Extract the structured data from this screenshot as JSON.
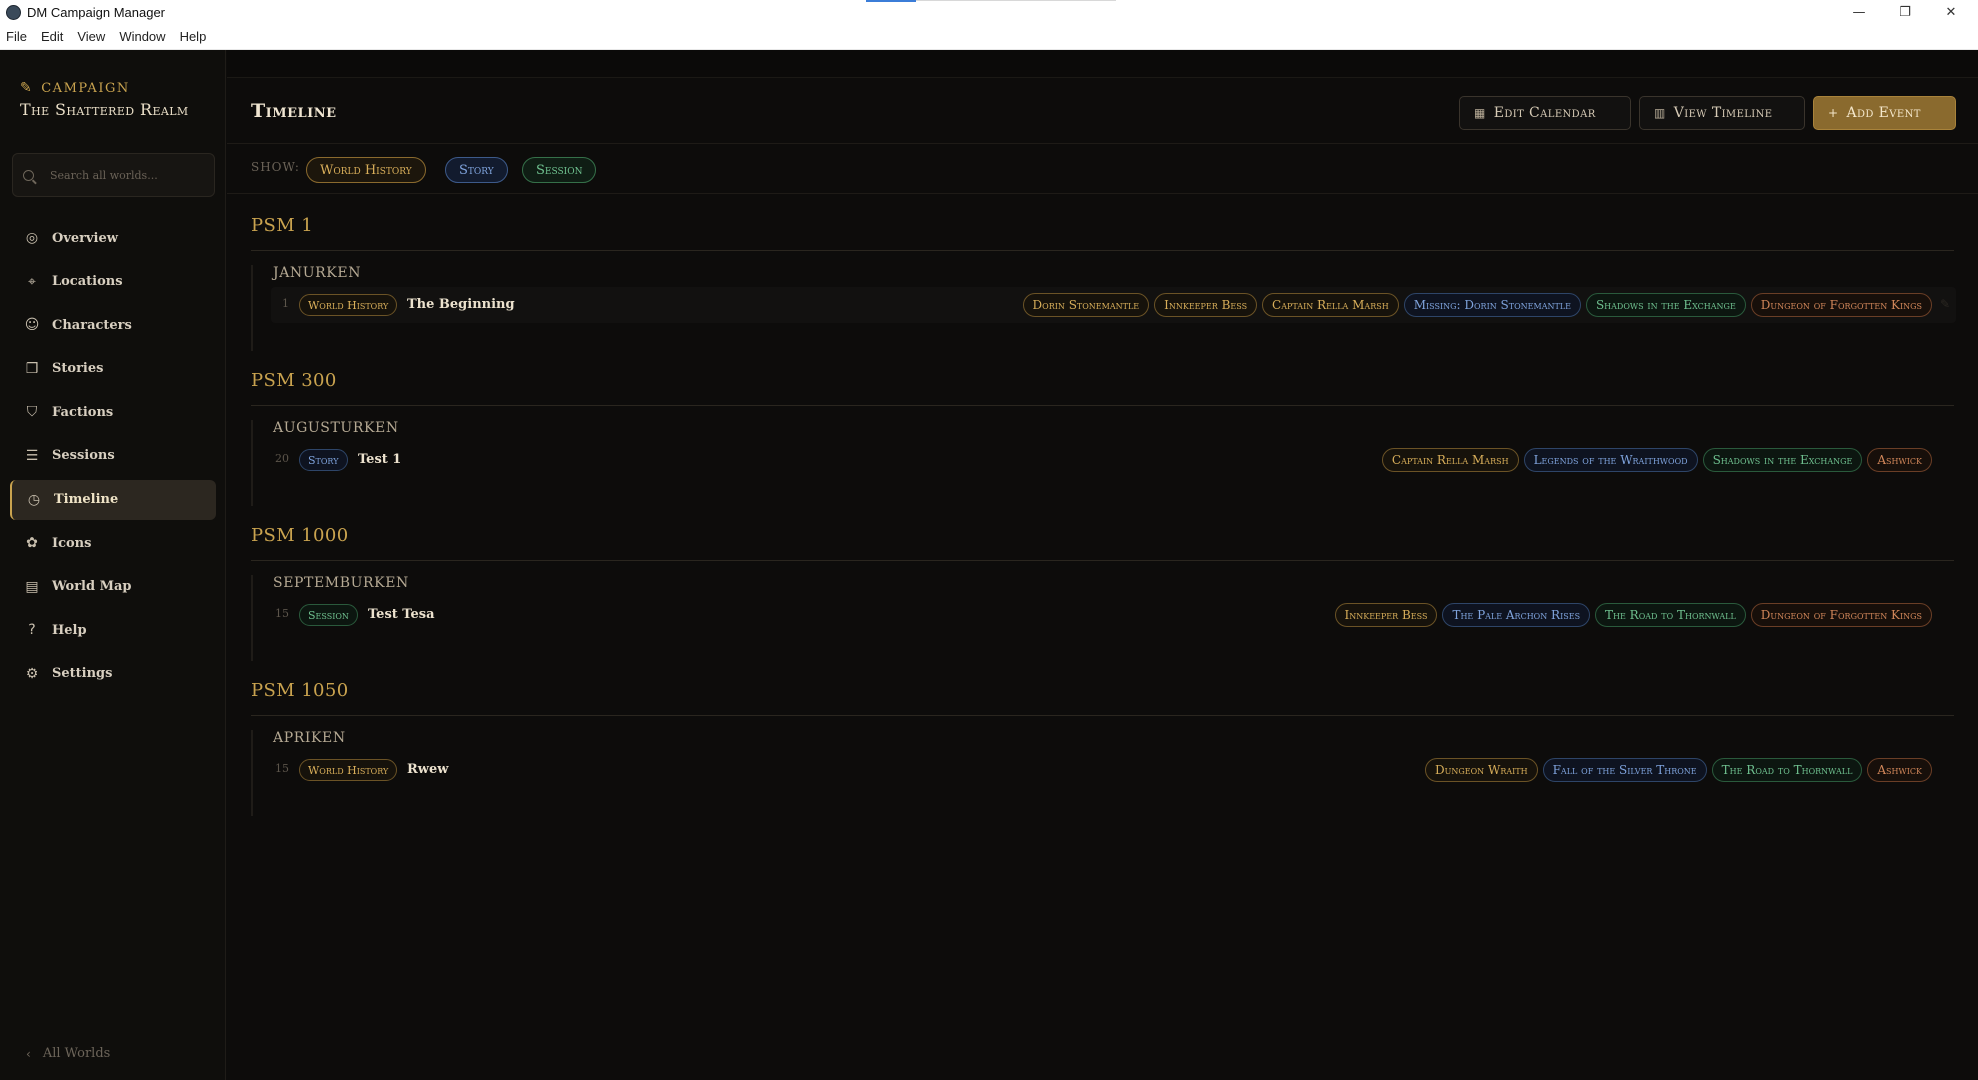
{
  "window": {
    "title": "DM Campaign Manager",
    "controls": {
      "minimize": "—",
      "restore": "❐",
      "close": "✕"
    }
  },
  "menu": [
    "File",
    "Edit",
    "View",
    "Window",
    "Help"
  ],
  "sidebar": {
    "campaign_label": "CAMPAIGN",
    "campaign_name": "The Shattered Realm",
    "search_placeholder": "Search all worlds...",
    "items": [
      {
        "label": "Overview",
        "icon": "globe-icon",
        "glyph": "◎"
      },
      {
        "label": "Locations",
        "icon": "map-pin-icon",
        "glyph": "⌖"
      },
      {
        "label": "Characters",
        "icon": "users-icon",
        "glyph": "☺"
      },
      {
        "label": "Stories",
        "icon": "book-icon",
        "glyph": "❒"
      },
      {
        "label": "Factions",
        "icon": "shield-icon",
        "glyph": "⛉"
      },
      {
        "label": "Sessions",
        "icon": "scroll-icon",
        "glyph": "☰"
      },
      {
        "label": "Timeline",
        "icon": "clock-icon",
        "glyph": "◷",
        "active": true
      },
      {
        "label": "Icons",
        "icon": "palette-icon",
        "glyph": "✿"
      },
      {
        "label": "World Map",
        "icon": "map-icon",
        "glyph": "▤"
      },
      {
        "label": "Help",
        "icon": "help-icon",
        "glyph": "?"
      },
      {
        "label": "Settings",
        "icon": "gear-icon",
        "glyph": "⚙"
      }
    ],
    "back_label": "All Worlds"
  },
  "header": {
    "title": "Timeline",
    "edit_calendar": "Edit Calendar",
    "view_timeline": "View Timeline",
    "add_event": "Add Event"
  },
  "filters": {
    "show_label": "SHOW:",
    "chips": [
      "World History",
      "Story",
      "Session"
    ]
  },
  "timeline": [
    {
      "year": "PSM 1",
      "month": "JANURKEN",
      "day": "1",
      "type": "World History",
      "title": "The Beginning",
      "tags": [
        {
          "label": "Dorin Stonemantle",
          "kind": "gold"
        },
        {
          "label": "Innkeeper Bess",
          "kind": "gold"
        },
        {
          "label": "Captain Rella Marsh",
          "kind": "gold"
        },
        {
          "label": "Missing: Dorin Stonemantle",
          "kind": "blue"
        },
        {
          "label": "Shadows in the Exchange",
          "kind": "green"
        },
        {
          "label": "Dungeon of Forgotten Kings",
          "kind": "orange"
        }
      ]
    },
    {
      "year": "PSM 300",
      "month": "AUGUSTURKEN",
      "day": "20",
      "type": "Story",
      "title": "Test 1",
      "tags": [
        {
          "label": "Captain Rella Marsh",
          "kind": "gold"
        },
        {
          "label": "Legends of the Wraithwood",
          "kind": "blue"
        },
        {
          "label": "Shadows in the Exchange",
          "kind": "green"
        },
        {
          "label": "Ashwick",
          "kind": "orange"
        }
      ]
    },
    {
      "year": "PSM 1000",
      "month": "SEPTEMBURKEN",
      "day": "15",
      "type": "Session",
      "title": "Test Tesa",
      "tags": [
        {
          "label": "Innkeeper Bess",
          "kind": "gold"
        },
        {
          "label": "The Pale Archon Rises",
          "kind": "blue"
        },
        {
          "label": "The Road to Thornwall",
          "kind": "green"
        },
        {
          "label": "Dungeon of Forgotten Kings",
          "kind": "orange"
        }
      ]
    },
    {
      "year": "PSM 1050",
      "month": "APRIKEN",
      "day": "15",
      "type": "World History",
      "title": "Rwew",
      "tags": [
        {
          "label": "Dungeon Wraith",
          "kind": "gold"
        },
        {
          "label": "Fall of the Silver Throne",
          "kind": "blue"
        },
        {
          "label": "The Road to Thornwall",
          "kind": "green"
        },
        {
          "label": "Ashwick",
          "kind": "orange"
        }
      ]
    }
  ],
  "colors": {
    "accent_gold": "#c9a34f",
    "world_history": "#d8ae5a",
    "story": "#7fa3dc",
    "session": "#6fc08f",
    "location": "#d2875a"
  }
}
